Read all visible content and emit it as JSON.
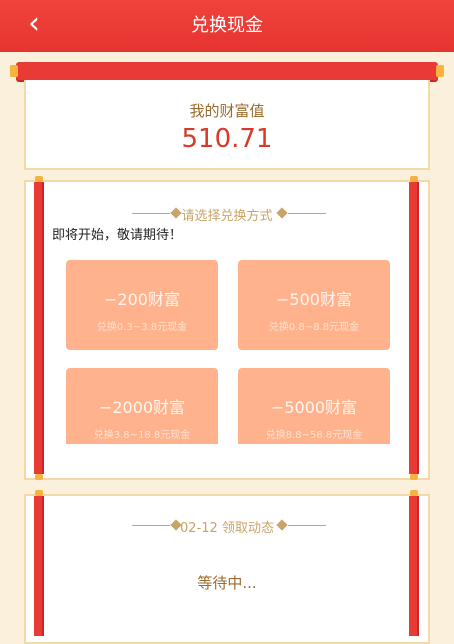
{
  "header": {
    "title": "兑换现金",
    "back_icon": "chevron-left-icon"
  },
  "wealth": {
    "label": "我的财富值",
    "value": "510.71"
  },
  "exchange": {
    "section_title": "请选择兑换方式",
    "notice": "即将开始，敬请期待！",
    "options": [
      {
        "amount": "−200财富",
        "desc": "兑换0.3~3.8元现金"
      },
      {
        "amount": "−500财富",
        "desc": "兑换0.8~8.8元现金"
      },
      {
        "amount": "−2000财富",
        "desc": "兑换3.8~18.8元现金"
      },
      {
        "amount": "−5000财富",
        "desc": "兑换8.8~58.8元现金"
      }
    ]
  },
  "activity": {
    "section_title": "02-12 领取动态",
    "status": "等待中..."
  },
  "colors": {
    "header_red": "#e63431",
    "card_orange": "#ffb28c",
    "gold": "#c9a468",
    "background": "#fbf0dc"
  }
}
